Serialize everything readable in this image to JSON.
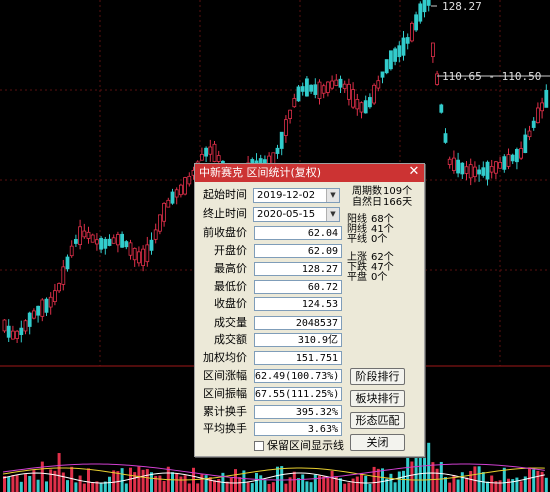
{
  "dialog": {
    "title": "中新赛克 区间统计(复权)",
    "close_label": "✕",
    "start_label": "起始时间",
    "start_date": "2019-12-02",
    "end_label": "终止时间",
    "end_date": "2020-05-15",
    "fields": [
      {
        "label": "前收盘价",
        "value": "62.04"
      },
      {
        "label": "开盘价",
        "value": "62.09"
      },
      {
        "label": "最高价",
        "value": "128.27"
      },
      {
        "label": "最低价",
        "value": "60.72"
      },
      {
        "label": "收盘价",
        "value": "124.53"
      },
      {
        "label": "成交量",
        "value": "2048537"
      },
      {
        "label": "成交额",
        "value": "310.9亿"
      },
      {
        "label": "加权均价",
        "value": "151.751"
      },
      {
        "label": "区间涨幅",
        "value": "62.49(100.73%)"
      },
      {
        "label": "区间振幅",
        "value": "67.55(111.25%)"
      },
      {
        "label": "累计换手",
        "value": "395.32%"
      },
      {
        "label": "平均换手",
        "value": "3.63%"
      }
    ],
    "stats": {
      "period_label": "周期数",
      "period_value": "109个",
      "natural_label": "自然日",
      "natural_value": "166天",
      "yang_label": "阳线",
      "yang_value": "68个",
      "yin_label": "阴线",
      "yin_value": "41个",
      "ping_label": "平线",
      "ping_value": "0个",
      "up_label": "上涨",
      "up_value": "62个",
      "down_label": "下跌",
      "down_value": "47个",
      "flat_label": "平盘",
      "flat_value": "0个"
    },
    "buttons": {
      "stage_rank": "阶段排行",
      "sector_rank": "板块排行",
      "pattern_match": "形态匹配",
      "close": "关闭"
    },
    "checkbox_label": "保留区间显示线"
  },
  "chart": {
    "high_label": "128.27",
    "range_label": "110.65 - 110.50",
    "up_color": "#e0304a",
    "down_color": "#33cccc"
  }
}
